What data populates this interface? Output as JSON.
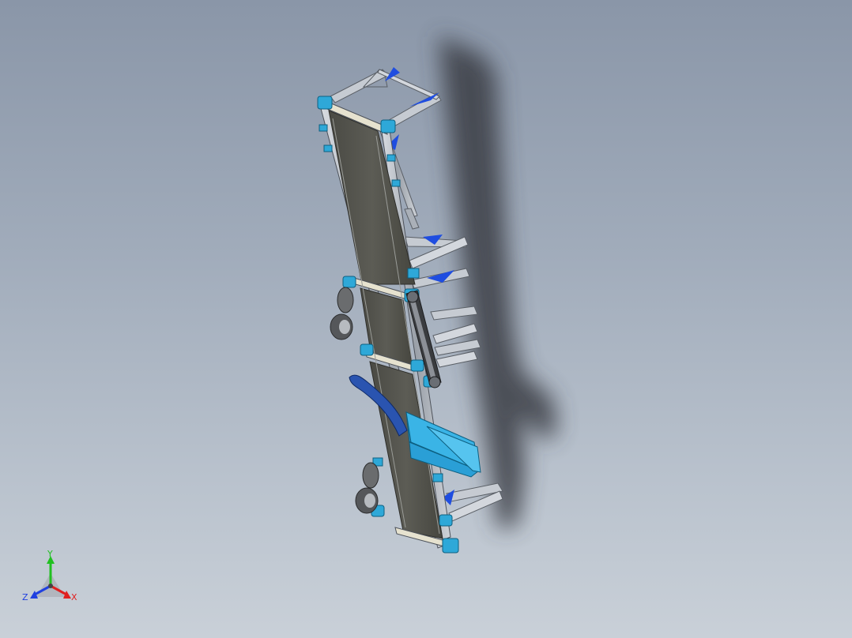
{
  "viewport": {
    "background_top": "#8a96a8",
    "background_bottom": "#c9d0d8"
  },
  "model": {
    "belt_color": "#55554e",
    "frame_color": "#b9bec6",
    "bracket_color": "#2ea8d8",
    "gusset_color": "#1f4de0",
    "chute_color": "#3ab4e6"
  },
  "triad": {
    "x_label": "X",
    "y_label": "Y",
    "z_label": "Z",
    "x_color": "#e02020",
    "y_color": "#20c020",
    "z_color": "#2040e0"
  }
}
